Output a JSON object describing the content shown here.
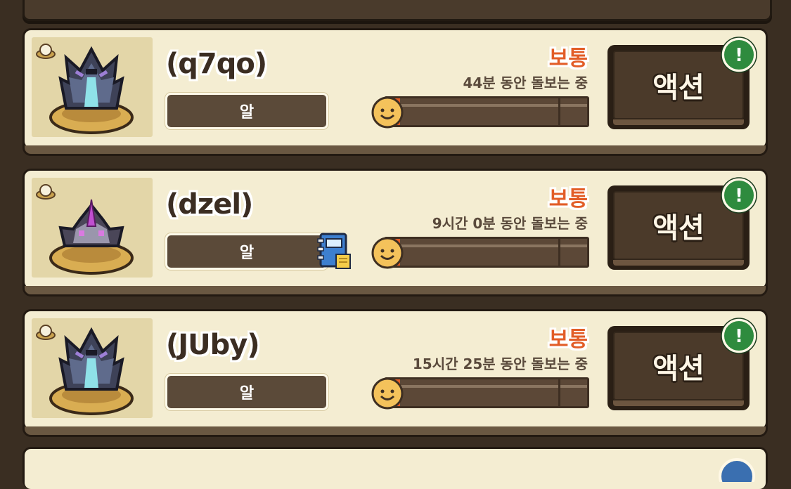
{
  "colors": {
    "background": "#3a2e22",
    "card": "#f4edd2",
    "status_orange": "#e25d27",
    "progress_track": "#5c4837",
    "alert_green": "#2e8b3e"
  },
  "pets": [
    {
      "name": "(q7qo)",
      "stage": "알",
      "status": "보통",
      "duration": "44분 동안 돌보는 중",
      "progress": 0.07,
      "has_notebook": false,
      "sprite_icon": "dark-dragon-egg-icon",
      "action_label": "액션",
      "alert_symbol": "!"
    },
    {
      "name": "(dzel)",
      "stage": "알",
      "status": "보통",
      "duration": "9시간 0분 동안 돌보는 중",
      "progress": 0.07,
      "has_notebook": true,
      "sprite_icon": "crystal-creature-egg-icon",
      "action_label": "액션",
      "alert_symbol": "!"
    },
    {
      "name": "(JUby)",
      "stage": "알",
      "status": "보통",
      "duration": "15시간 25분 동안 돌보는 중",
      "progress": 0.07,
      "has_notebook": false,
      "sprite_icon": "dark-dragon-egg-icon",
      "action_label": "액션",
      "alert_symbol": "!"
    }
  ]
}
